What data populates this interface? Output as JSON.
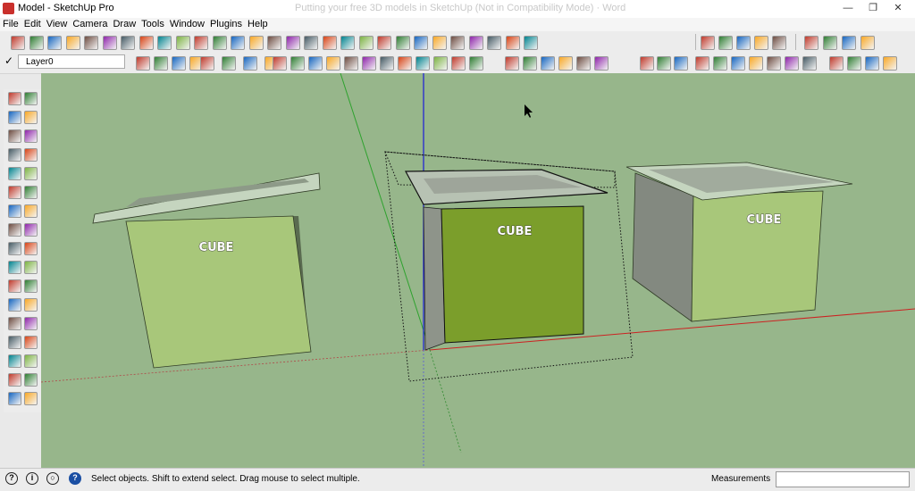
{
  "window": {
    "title": "Model - SketchUp Pro",
    "faded_caption": "Putting your free 3D models in SketchUp   (Not in Compatibility Mode)  ·  Word",
    "minimize": "—",
    "maximize": "❐",
    "close": "✕"
  },
  "menu": [
    "File",
    "Edit",
    "View",
    "Camera",
    "Draw",
    "Tools",
    "Window",
    "Plugins",
    "Help"
  ],
  "layer": {
    "check": "✓",
    "name": "Layer0"
  },
  "models": [
    {
      "label": "CUBE"
    },
    {
      "label": "CUBE"
    },
    {
      "label": "CUBE"
    }
  ],
  "status": {
    "text": "Select objects. Shift to extend select. Drag mouse to select multiple.",
    "measurements_label": "Measurements",
    "measurements_value": "",
    "geo_icon": "?",
    "info_icon": "i",
    "user_icon": "○",
    "help_icon": "?"
  },
  "colors": {
    "viewport_bg": "#97b68b",
    "cube_face": "#a8c77a",
    "cube_face_selected": "#7b9e2b",
    "axis_red": "#cc2222",
    "axis_green": "#2ea22e",
    "axis_blue": "#1c1cd8"
  }
}
